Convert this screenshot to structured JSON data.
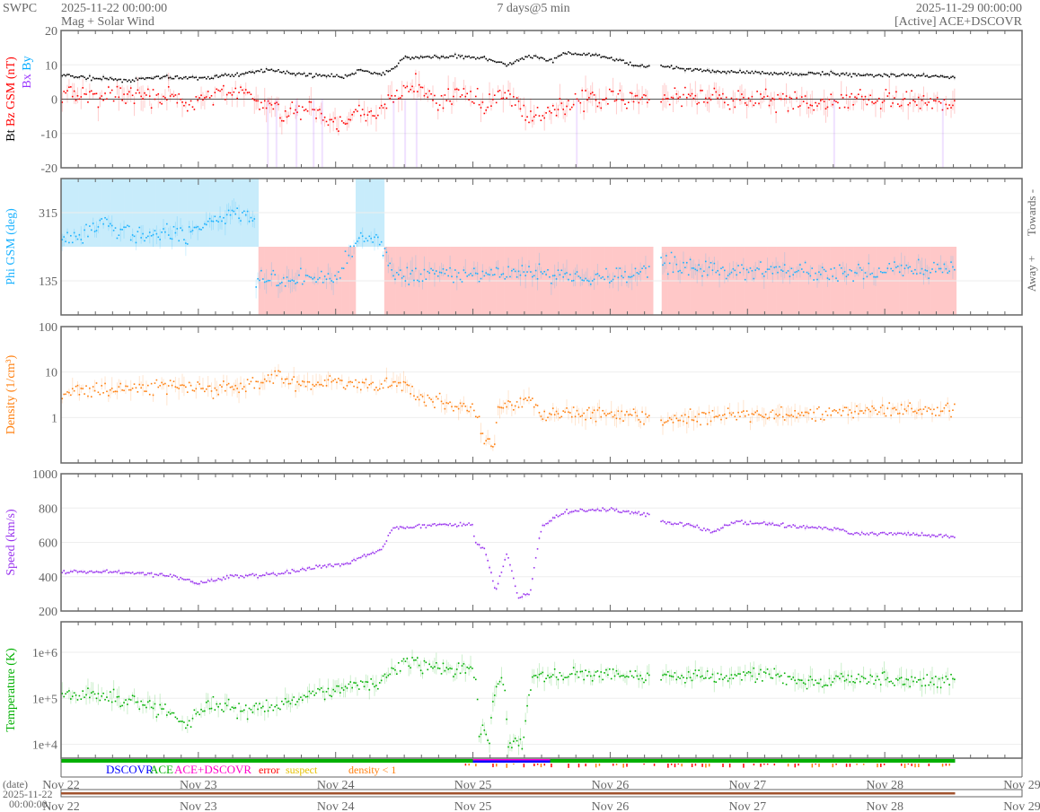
{
  "header": {
    "org": "SWPC",
    "start": "2025-11-22 00:00:00",
    "subtitle": "Mag + Solar Wind",
    "span": "7 days@5 min",
    "end": "2025-11-29 00:00:00",
    "source": "[Active] ACE+DSCOVR"
  },
  "colors": {
    "bt": "#000000",
    "bz": "#ff0000",
    "bx": "#9933ff",
    "by": "#00aaff",
    "phi": "#1ab2ff",
    "towards": "#c8ecfb",
    "away": "#ffc8c8",
    "density": "#ff7f0e",
    "speed": "#9933ee",
    "temp": "#00b000",
    "ace": "#00b000",
    "dscovr": "#0000ff",
    "both": "#ff00cc",
    "error": "#ff0000",
    "suspect": "#e6c000",
    "lowdens": "#ff7f0e",
    "date": "#a0522d"
  },
  "legend": {
    "dscovr": "DSCOVR",
    "ace": "ACE",
    "both": "ACE+DSCOVR",
    "error": "error",
    "suspect": "suspect",
    "lowdens": "density < 1"
  },
  "date_axis": {
    "label": "(date)",
    "date": "2025-11-22",
    "time": "00:00:00"
  },
  "chart_data": {
    "type": "line",
    "x_unit": "hours since 2025-11-22 00:00 UTC",
    "xlim": [
      0,
      168
    ],
    "x_tick_labels": [
      "Nov 22",
      "Nov 23",
      "Nov 24",
      "Nov 25",
      "Nov 26",
      "Nov 27",
      "Nov 28",
      "Nov 29"
    ],
    "data_gap": [
      103,
      104.6
    ],
    "data_end": 156.3,
    "panels": [
      {
        "id": "mag",
        "ylabel_parts": [
          "Bt",
          "Bz GSM (nT)"
        ],
        "legend2": [
          "Bx",
          "By"
        ],
        "scale": "linear",
        "ylim": [
          -20,
          20
        ],
        "ticks": [
          20,
          10,
          0,
          -10,
          -20
        ],
        "tick_labels": [
          "20",
          "10",
          "0",
          "-10",
          "-20"
        ],
        "series": [
          {
            "name": "Bt",
            "color_key": "bt",
            "noise": 0.4,
            "points": [
              [
                0,
                7
              ],
              [
                6,
                6
              ],
              [
                12,
                5.5
              ],
              [
                18,
                6.5
              ],
              [
                24,
                6
              ],
              [
                30,
                7
              ],
              [
                36,
                8.5
              ],
              [
                44,
                7
              ],
              [
                50,
                6.5
              ],
              [
                52,
                8.5
              ],
              [
                56,
                7
              ],
              [
                58,
                9
              ],
              [
                60,
                12
              ],
              [
                70,
                12.5
              ],
              [
                74,
                12
              ],
              [
                78,
                10
              ],
              [
                82,
                12.5
              ],
              [
                86,
                11
              ],
              [
                88,
                13.5
              ],
              [
                92,
                13
              ],
              [
                96,
                12
              ],
              [
                100,
                10
              ],
              [
                108,
                9
              ],
              [
                116,
                8
              ],
              [
                124,
                7.5
              ],
              [
                132,
                7.5
              ],
              [
                140,
                7
              ],
              [
                148,
                7
              ],
              [
                156,
                6.5
              ]
            ]
          },
          {
            "name": "Bz",
            "color_key": "bz",
            "noise": 2.2,
            "points": [
              [
                0,
                2
              ],
              [
                6,
                1
              ],
              [
                12,
                1
              ],
              [
                18,
                0
              ],
              [
                24,
                -1
              ],
              [
                28,
                2
              ],
              [
                32,
                2
              ],
              [
                36,
                -2
              ],
              [
                40,
                -4
              ],
              [
                44,
                -3
              ],
              [
                48,
                -7
              ],
              [
                52,
                -3
              ],
              [
                54,
                -6
              ],
              [
                58,
                0
              ],
              [
                62,
                4
              ],
              [
                66,
                -1
              ],
              [
                70,
                2
              ],
              [
                74,
                -2
              ],
              [
                78,
                2
              ],
              [
                82,
                -6
              ],
              [
                86,
                -3
              ],
              [
                90,
                -1
              ],
              [
                96,
                1
              ],
              [
                102,
                0
              ],
              [
                108,
                0
              ],
              [
                116,
                0
              ],
              [
                124,
                0
              ],
              [
                132,
                -1
              ],
              [
                140,
                0
              ],
              [
                148,
                0
              ],
              [
                156,
                -1
              ]
            ]
          }
        ]
      },
      {
        "id": "phi",
        "ylabel_parts": [
          "Phi GSM (deg)"
        ],
        "right_labels": [
          "Towards -",
          "Away +"
        ],
        "scale": "linear",
        "ylim": [
          45,
          405
        ],
        "ticks": [
          315,
          135
        ],
        "tick_labels": [
          "315",
          "135"
        ],
        "sector_boundary": 225,
        "series": [
          {
            "name": "Phi",
            "color_key": "phi",
            "noise": 18,
            "points": [
              [
                0,
                245
              ],
              [
                4,
                260
              ],
              [
                8,
                300
              ],
              [
                10,
                270
              ],
              [
                14,
                250
              ],
              [
                18,
                260
              ],
              [
                22,
                255
              ],
              [
                26,
                290
              ],
              [
                30,
                320
              ],
              [
                34,
                300
              ],
              [
                34.1,
                140
              ],
              [
                40,
                135
              ],
              [
                44,
                145
              ],
              [
                48,
                140
              ],
              [
                52,
                250
              ],
              [
                56,
                240
              ],
              [
                58,
                150
              ],
              [
                64,
                150
              ],
              [
                72,
                150
              ],
              [
                80,
                160
              ],
              [
                90,
                145
              ],
              [
                100,
                150
              ],
              [
                104.6,
                190
              ],
              [
                110,
                170
              ],
              [
                118,
                160
              ],
              [
                126,
                165
              ],
              [
                134,
                150
              ],
              [
                142,
                160
              ],
              [
                150,
                160
              ],
              [
                156,
                165
              ]
            ]
          }
        ]
      },
      {
        "id": "density",
        "ylabel_parts": [
          "Density (1/cm³)"
        ],
        "scale": "log",
        "ylim": [
          0.1,
          100
        ],
        "ticks": [
          100,
          10,
          1
        ],
        "tick_labels": [
          "100",
          "10",
          "1"
        ],
        "series": [
          {
            "name": "Density",
            "color_key": "density",
            "noise": 0.12,
            "points": [
              [
                0,
                3.8
              ],
              [
                8,
                4
              ],
              [
                14,
                4.5
              ],
              [
                20,
                5.5
              ],
              [
                24,
                4
              ],
              [
                30,
                4.5
              ],
              [
                36,
                6.5
              ],
              [
                38,
                9
              ],
              [
                40,
                6
              ],
              [
                48,
                5.5
              ],
              [
                56,
                5
              ],
              [
                60,
                6
              ],
              [
                62,
                3
              ],
              [
                68,
                1.8
              ],
              [
                72,
                1.5
              ],
              [
                74,
                0.3
              ],
              [
                76,
                0.3
              ],
              [
                76.5,
                2
              ],
              [
                78,
                2
              ],
              [
                82,
                2.5
              ],
              [
                84,
                1.2
              ],
              [
                96,
                1.2
              ],
              [
                103,
                1
              ],
              [
                104.6,
                0.9
              ],
              [
                112,
                1
              ],
              [
                120,
                1.1
              ],
              [
                130,
                1.2
              ],
              [
                140,
                1.4
              ],
              [
                150,
                1.6
              ],
              [
                156,
                1.5
              ]
            ]
          }
        ]
      },
      {
        "id": "speed",
        "ylabel_parts": [
          "Speed (km/s)"
        ],
        "scale": "linear",
        "ylim": [
          200,
          1000
        ],
        "ticks": [
          1000,
          800,
          600,
          400,
          200
        ],
        "tick_labels": [
          "1000",
          "800",
          "600",
          "400",
          "200"
        ],
        "series": [
          {
            "name": "Speed",
            "color_key": "speed",
            "noise": 8,
            "points": [
              [
                0,
                430
              ],
              [
                8,
                430
              ],
              [
                14,
                420
              ],
              [
                20,
                400
              ],
              [
                24,
                360
              ],
              [
                30,
                400
              ],
              [
                36,
                410
              ],
              [
                44,
                450
              ],
              [
                50,
                480
              ],
              [
                56,
                560
              ],
              [
                58,
                680
              ],
              [
                64,
                700
              ],
              [
                72,
                710
              ],
              [
                72.3,
                600
              ],
              [
                74,
                560
              ],
              [
                76,
                320
              ],
              [
                78,
                540
              ],
              [
                80,
                270
              ],
              [
                82,
                310
              ],
              [
                83,
                500
              ],
              [
                84,
                690
              ],
              [
                88,
                780
              ],
              [
                96,
                790
              ],
              [
                103,
                760
              ],
              [
                104.6,
                720
              ],
              [
                110,
                700
              ],
              [
                114,
                660
              ],
              [
                118,
                720
              ],
              [
                126,
                700
              ],
              [
                134,
                680
              ],
              [
                140,
                650
              ],
              [
                148,
                650
              ],
              [
                156,
                630
              ]
            ]
          }
        ]
      },
      {
        "id": "temp",
        "ylabel_parts": [
          "Temperature (K)"
        ],
        "scale": "log",
        "ylim": [
          5000,
          4600000
        ],
        "ticks": [
          1000000,
          100000,
          10000
        ],
        "tick_labels": [
          "1e+6",
          "1e+5",
          "1e+4"
        ],
        "series": [
          {
            "name": "Temperature",
            "color_key": "temp",
            "noise": 0.12,
            "points": [
              [
                0,
                110000
              ],
              [
                6,
                120000
              ],
              [
                12,
                90000
              ],
              [
                18,
                50000
              ],
              [
                22,
                25000
              ],
              [
                26,
                80000
              ],
              [
                32,
                50000
              ],
              [
                40,
                80000
              ],
              [
                48,
                150000
              ],
              [
                56,
                250000
              ],
              [
                60,
                600000
              ],
              [
                64,
                500000
              ],
              [
                72,
                400000
              ],
              [
                73,
                20000
              ],
              [
                75,
                8000
              ],
              [
                77,
                300000
              ],
              [
                78,
                10000
              ],
              [
                81,
                12000
              ],
              [
                83,
                300000
              ],
              [
                90,
                320000
              ],
              [
                98,
                350000
              ],
              [
                103,
                280000
              ],
              [
                104.6,
                300000
              ],
              [
                112,
                320000
              ],
              [
                118,
                300000
              ],
              [
                124,
                350000
              ],
              [
                132,
                200000
              ],
              [
                140,
                300000
              ],
              [
                148,
                220000
              ],
              [
                156,
                250000
              ]
            ]
          }
        ]
      }
    ],
    "status_bar": {
      "default_source": "ACE",
      "dscovr_interval": [
        72,
        85.5
      ],
      "dscovr_days": [
        "Nov 25"
      ]
    }
  }
}
